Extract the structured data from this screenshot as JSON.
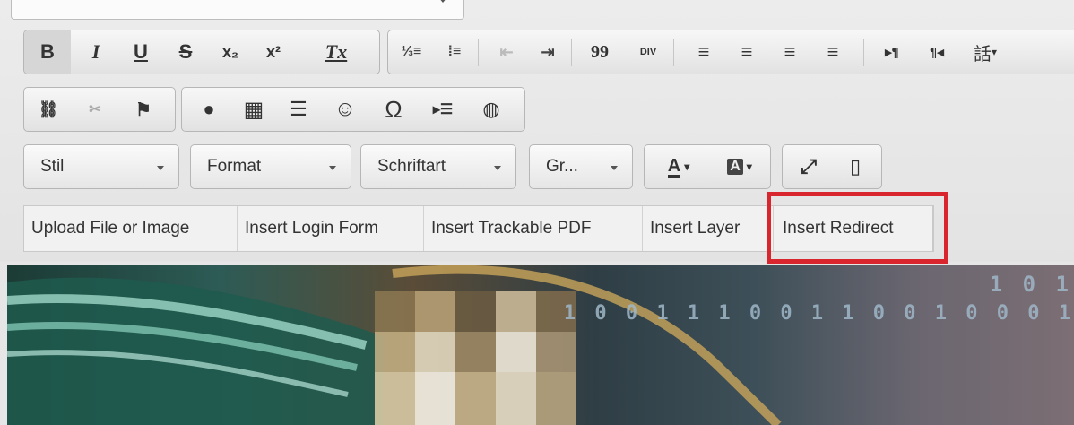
{
  "editor": {
    "row1": {
      "bold": "B",
      "italic": "I",
      "underline": "U",
      "strike": "S",
      "subscript": "x₂",
      "superscript": "x²",
      "remove_format": "Tx",
      "numbered_list": "⅓≡",
      "bulleted_list": "⁞≡",
      "outdent": "⇤",
      "indent": "⇥",
      "blockquote": "99",
      "div": "DIV",
      "align_left": "≡",
      "align_center": "≡",
      "align_right": "≡",
      "justify": "≡",
      "ltr": "▸¶",
      "rtl": "¶◂",
      "language": "話"
    },
    "row2": {
      "link": "⛓",
      "unlink": "✂",
      "anchor": "⚑",
      "flash": "●",
      "table": "▦",
      "hr": "☰",
      "smiley": "☺",
      "special_char": "Ω",
      "page_break": "▸☰",
      "iframe": "◍"
    },
    "row3": {
      "style_label": "Stil",
      "format_label": "Format",
      "font_label": "Schriftart",
      "size_label": "Gr...",
      "text_color": "A",
      "bg_color": "A",
      "maximize": "⤢",
      "show_blocks": "▯"
    },
    "plugins": [
      {
        "label": "Upload File or Image"
      },
      {
        "label": "Insert Login Form"
      },
      {
        "label": "Insert Trackable PDF"
      },
      {
        "label": "Insert Layer"
      },
      {
        "label": "Insert Redirect"
      }
    ]
  },
  "banner": {
    "binary_top": "1 0 1",
    "binary_mid": "1 0 0 1 1 1 0 0 1 1 0 0 1 0 0 0 1"
  },
  "colors": {
    "highlight": "#d9262e"
  }
}
